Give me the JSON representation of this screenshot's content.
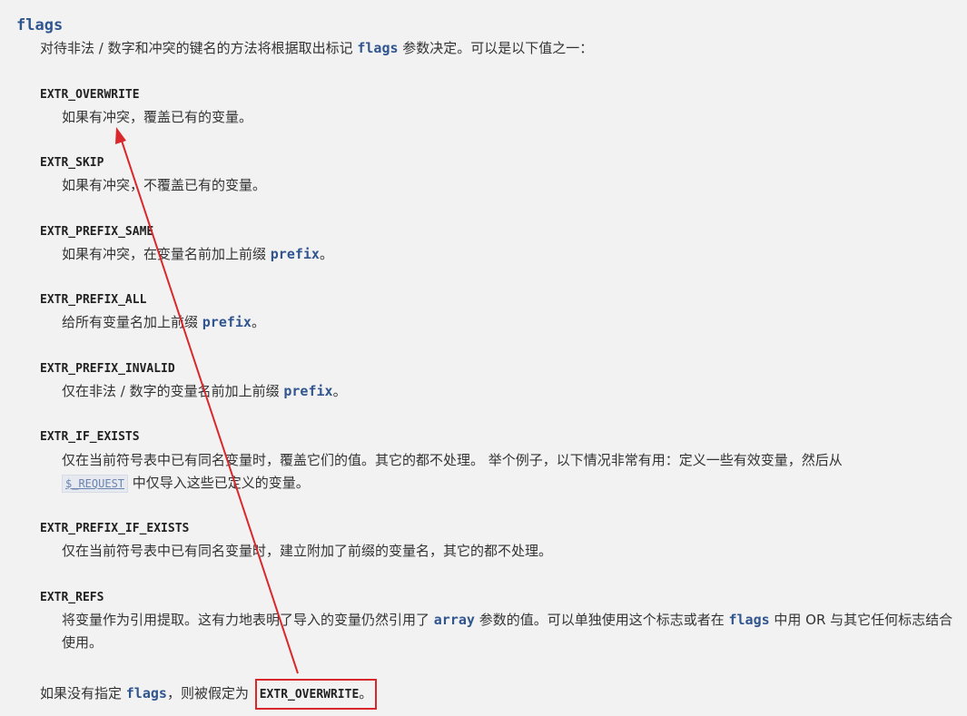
{
  "heading": "flags",
  "intro": {
    "before": "对待非法 / 数字和冲突的键名的方法将根据取出标记 ",
    "code": "flags",
    "after": " 参数决定。可以是以下值之一："
  },
  "constants": [
    {
      "name": "EXTR_OVERWRITE",
      "desc": "如果有冲突，覆盖已有的变量。"
    },
    {
      "name": "EXTR_SKIP",
      "desc": "如果有冲突，不覆盖已有的变量。"
    },
    {
      "name": "EXTR_PREFIX_SAME",
      "desc_before": "如果有冲突，在变量名前加上前缀 ",
      "code": "prefix",
      "desc_after": "。"
    },
    {
      "name": "EXTR_PREFIX_ALL",
      "desc_before": "给所有变量名加上前缀 ",
      "code": "prefix",
      "desc_after": "。"
    },
    {
      "name": "EXTR_PREFIX_INVALID",
      "desc_before": "仅在非法 / 数字的变量名前加上前缀 ",
      "code": "prefix",
      "desc_after": "。"
    },
    {
      "name": "EXTR_IF_EXISTS",
      "desc_line1": "仅在当前符号表中已有同名变量时，覆盖它们的值。其它的都不处理。 举个例子，以下情况非常有用：定义一些有效变量，然后从",
      "link": "$_REQUEST",
      "desc_line2": " 中仅导入这些已定义的变量。"
    },
    {
      "name": "EXTR_PREFIX_IF_EXISTS",
      "desc": "仅在当前符号表中已有同名变量时，建立附加了前缀的变量名，其它的都不处理。"
    },
    {
      "name": "EXTR_REFS",
      "desc_before": "将变量作为引用提取。这有力地表明了导入的变量仍然引用了 ",
      "code1": "array",
      "desc_middle": " 参数的值。可以单独使用这个标志或者在 ",
      "code2": "flags",
      "desc_after": " 中用 OR 与其它任何标志结合使用。"
    }
  ],
  "footer": {
    "before": "如果没有指定 ",
    "code": "flags",
    "middle": "，则被假定为 ",
    "boxed_code": "EXTR_OVERWRITE",
    "boxed_after": "。"
  },
  "colors": {
    "accent": "#30558f",
    "annotation": "#d9282c",
    "background": "#f2f2f2"
  }
}
